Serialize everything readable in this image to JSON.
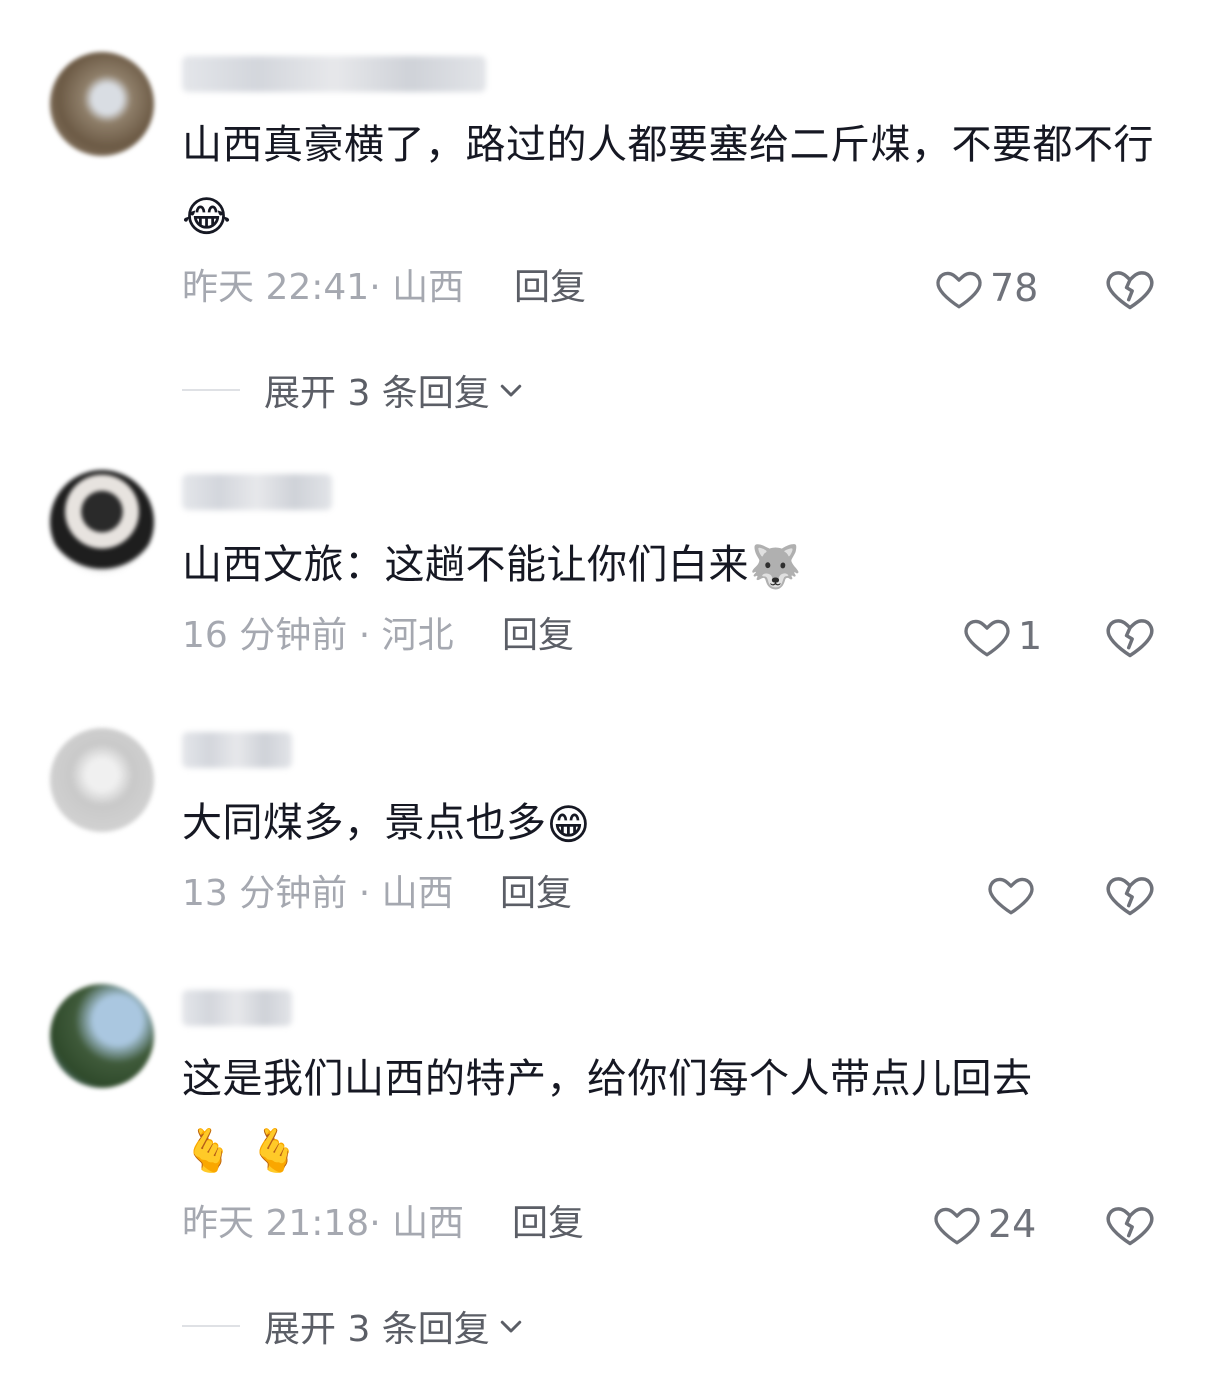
{
  "comments": [
    {
      "text": "山西真豪横了，路过的人都要塞给二斤煤，不要都不行",
      "emoji": "😂",
      "time_location": "昨天 22:41· 山西",
      "reply_label": "回复",
      "likes": "78",
      "expand_label": "展开 3 条回复"
    },
    {
      "text": "山西文旅：这趟不能让你们白来",
      "emoji": "🐺",
      "time_location": "16 分钟前 · 河北",
      "reply_label": "回复",
      "likes": "1"
    },
    {
      "text": "大同煤多，景点也多",
      "emoji": "😁",
      "time_location": "13 分钟前 · 山西",
      "reply_label": "回复",
      "likes": ""
    },
    {
      "text": "这是我们山西的特产，给你们每个人带点儿回去",
      "emoji": "🫰🫰",
      "time_location": "昨天 21:18· 山西",
      "reply_label": "回复",
      "likes": "24",
      "expand_label": "展开 3 条回复"
    }
  ],
  "icons": {
    "like": "heart-outline-icon",
    "dislike": "broken-heart-icon",
    "expand": "chevron-down-icon"
  },
  "colors": {
    "text": "#161823",
    "meta": "#a5a8b0",
    "action": "#5b5e66"
  }
}
